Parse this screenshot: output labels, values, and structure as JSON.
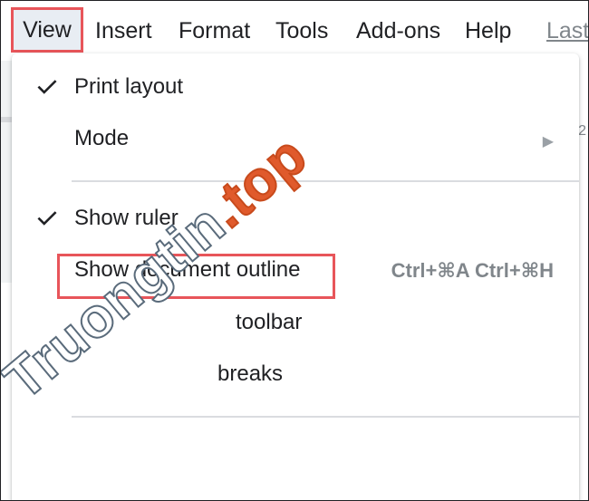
{
  "menubar": {
    "items": [
      {
        "label": "View"
      },
      {
        "label": "Insert"
      },
      {
        "label": "Format"
      },
      {
        "label": "Tools"
      },
      {
        "label": "Add-ons"
      },
      {
        "label": "Help"
      },
      {
        "label": "Last"
      }
    ]
  },
  "ruler_glimpse": "2",
  "view_menu": {
    "items": [
      {
        "label": "Print layout",
        "checked": true
      },
      {
        "label": "Mode",
        "submenu_arrow": "▶"
      },
      {
        "label": "Show ruler",
        "checked": true
      },
      {
        "label": "Show document outline",
        "shortcut": "Ctrl+⌘A Ctrl+⌘H"
      },
      {
        "label": "toolbar"
      },
      {
        "label": "breaks"
      }
    ]
  },
  "colors": {
    "highlight_border": "#e8555a",
    "menu_bg": "#ffffff",
    "text": "#202124",
    "muted": "#80868b"
  },
  "watermark": {
    "text_main": "Truongtin",
    "text_dot": ".",
    "text_tld": "top"
  }
}
